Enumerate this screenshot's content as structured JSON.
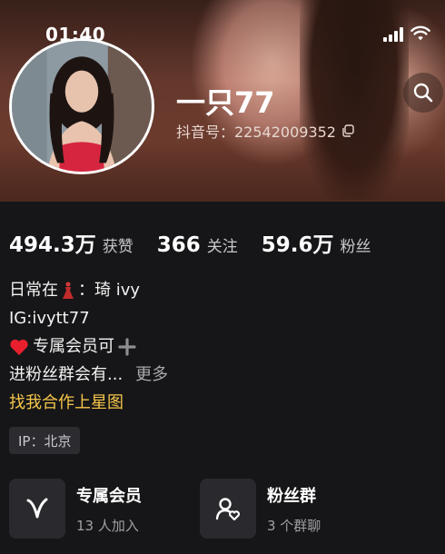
{
  "status_bar": {
    "time": "01:40",
    "signal_icon": "cellular-signal-icon",
    "wifi_icon": "wifi-icon"
  },
  "header": {
    "back_icon": "back-chevron-icon",
    "search_icon": "search-icon"
  },
  "profile": {
    "nickname": "一只77",
    "douyin_id": "抖音号：22542009352",
    "copy_icon": "copy-icon"
  },
  "stats": [
    {
      "value": "494.3万",
      "label": "获赞"
    },
    {
      "value": "366",
      "label": "关注"
    },
    {
      "value": "59.6万",
      "label": "粉丝"
    }
  ],
  "bio": {
    "line1_prefix": "日常在",
    "line1_suffix": "：琦 ivy",
    "line2": "IG:ivytt77",
    "line3": "专属会员可",
    "line4": "进粉丝群会有...",
    "more": "更多",
    "collab": "找我合作上星图"
  },
  "ip": "IP：北京",
  "cards": [
    {
      "title": "专属会员",
      "subtitle": "13 人加入",
      "icon": "membership-v-icon"
    },
    {
      "title": "粉丝群",
      "subtitle": "3 个群聊",
      "icon": "fan-group-icon"
    }
  ],
  "colors": {
    "background": "#161618",
    "collab_accent": "#f5c64a",
    "secondary_text": "#c8c8cc"
  }
}
